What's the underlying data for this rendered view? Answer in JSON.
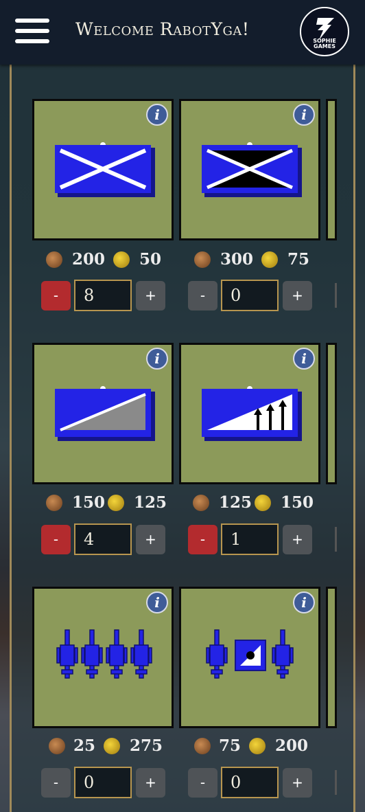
{
  "header": {
    "title": "Welcome RabotYga!",
    "logo_text": "SOPHIE GAMES"
  },
  "icons": {
    "menu": "hamburger-menu-icon",
    "info": "info-icon",
    "wood": "wood-resource-icon",
    "gold": "gold-resource-icon"
  },
  "units": [
    {
      "name": "saltire-white",
      "wood": "200",
      "gold": "50",
      "qty": "8",
      "minus": "-",
      "plus": "+",
      "info": "i"
    },
    {
      "name": "saltire-black",
      "wood": "300",
      "gold": "75",
      "qty": "0",
      "minus": "-",
      "plus": "+",
      "info": "i"
    },
    {
      "name": "diagonal-grey",
      "wood": "150",
      "gold": "125",
      "qty": "4",
      "minus": "-",
      "plus": "+",
      "info": "i"
    },
    {
      "name": "diagonal-spears",
      "wood": "125",
      "gold": "150",
      "qty": "1",
      "minus": "-",
      "plus": "+",
      "info": "i"
    },
    {
      "name": "four-cannons",
      "wood": "25",
      "gold": "275",
      "qty": "0",
      "minus": "-",
      "plus": "+",
      "info": "i"
    },
    {
      "name": "cannons-emblem",
      "wood": "75",
      "gold": "200",
      "qty": "0",
      "minus": "-",
      "plus": "+",
      "info": "i"
    }
  ],
  "colors": {
    "unit_blue": "#2323e6",
    "card_bg": "#8c9a5a",
    "minus_active": "#b32b2e",
    "button_idle": "#4f5357"
  }
}
